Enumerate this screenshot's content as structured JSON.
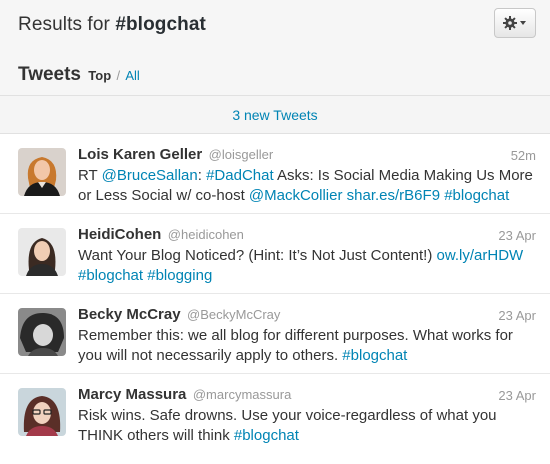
{
  "header": {
    "results_prefix": "Results for",
    "query": "#blogchat",
    "gear_icon": "gear-icon"
  },
  "tabs": {
    "heading": "Tweets",
    "top": "Top",
    "separator": "/",
    "all": "All"
  },
  "new_tweets": "3 new Tweets",
  "tweets": [
    {
      "fullname": "Lois Karen Geller",
      "username": "@loisgeller",
      "time": "52m",
      "parts": [
        {
          "t": "RT ",
          "link": false
        },
        {
          "t": "@BruceSallan",
          "link": true
        },
        {
          "t": ": ",
          "link": false
        },
        {
          "t": "#DadChat",
          "link": true
        },
        {
          "t": " Asks: Is Social Media Making Us More or Less Social w/ co-host ",
          "link": false
        },
        {
          "t": "@MackCollier",
          "link": true
        },
        {
          "t": " ",
          "link": false
        },
        {
          "t": "shar.es/rB6F9",
          "link": true
        },
        {
          "t": " ",
          "link": false
        },
        {
          "t": "#blogchat",
          "link": true
        }
      ]
    },
    {
      "fullname": "HeidiCohen",
      "username": "@heidicohen",
      "time": "23 Apr",
      "parts": [
        {
          "t": "Want Your Blog Noticed? (Hint: It’s Not Just Content!) ",
          "link": false
        },
        {
          "t": "ow.ly/arHDW",
          "link": true
        },
        {
          "t": " ",
          "link": false
        },
        {
          "t": "#blogchat",
          "link": true
        },
        {
          "t": " ",
          "link": false
        },
        {
          "t": "#blogging",
          "link": true
        }
      ]
    },
    {
      "fullname": "Becky McCray",
      "username": "@BeckyMcCray",
      "time": "23 Apr",
      "parts": [
        {
          "t": "Remember this: we all blog for different purposes. What works for you will not necessarily apply to others. ",
          "link": false
        },
        {
          "t": "#blogchat",
          "link": true
        }
      ]
    },
    {
      "fullname": "Marcy Massura",
      "username": "@marcymassura",
      "time": "23 Apr",
      "parts": [
        {
          "t": "Risk wins. Safe drowns. Use your voice-regardless of what you THINK others will think ",
          "link": false
        },
        {
          "t": "#blogchat",
          "link": true
        }
      ]
    }
  ]
}
